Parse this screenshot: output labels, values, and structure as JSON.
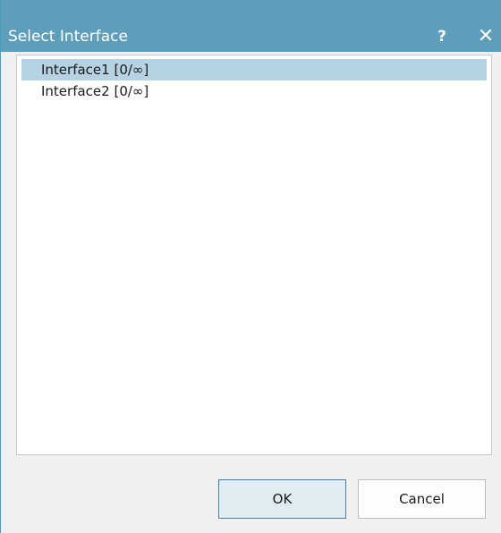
{
  "window": {
    "title": "Select Interface",
    "help_label": "?",
    "close_label": "✕"
  },
  "list": {
    "items": [
      {
        "label": "Interface1 [0/∞]",
        "selected": true
      },
      {
        "label": "Interface2 [0/∞]",
        "selected": false
      }
    ]
  },
  "buttons": {
    "ok_label": "OK",
    "cancel_label": "Cancel"
  },
  "colors": {
    "titlebar": "#5d9fba",
    "selection": "#b5d3e3",
    "ok_border": "#4c7fa0"
  }
}
